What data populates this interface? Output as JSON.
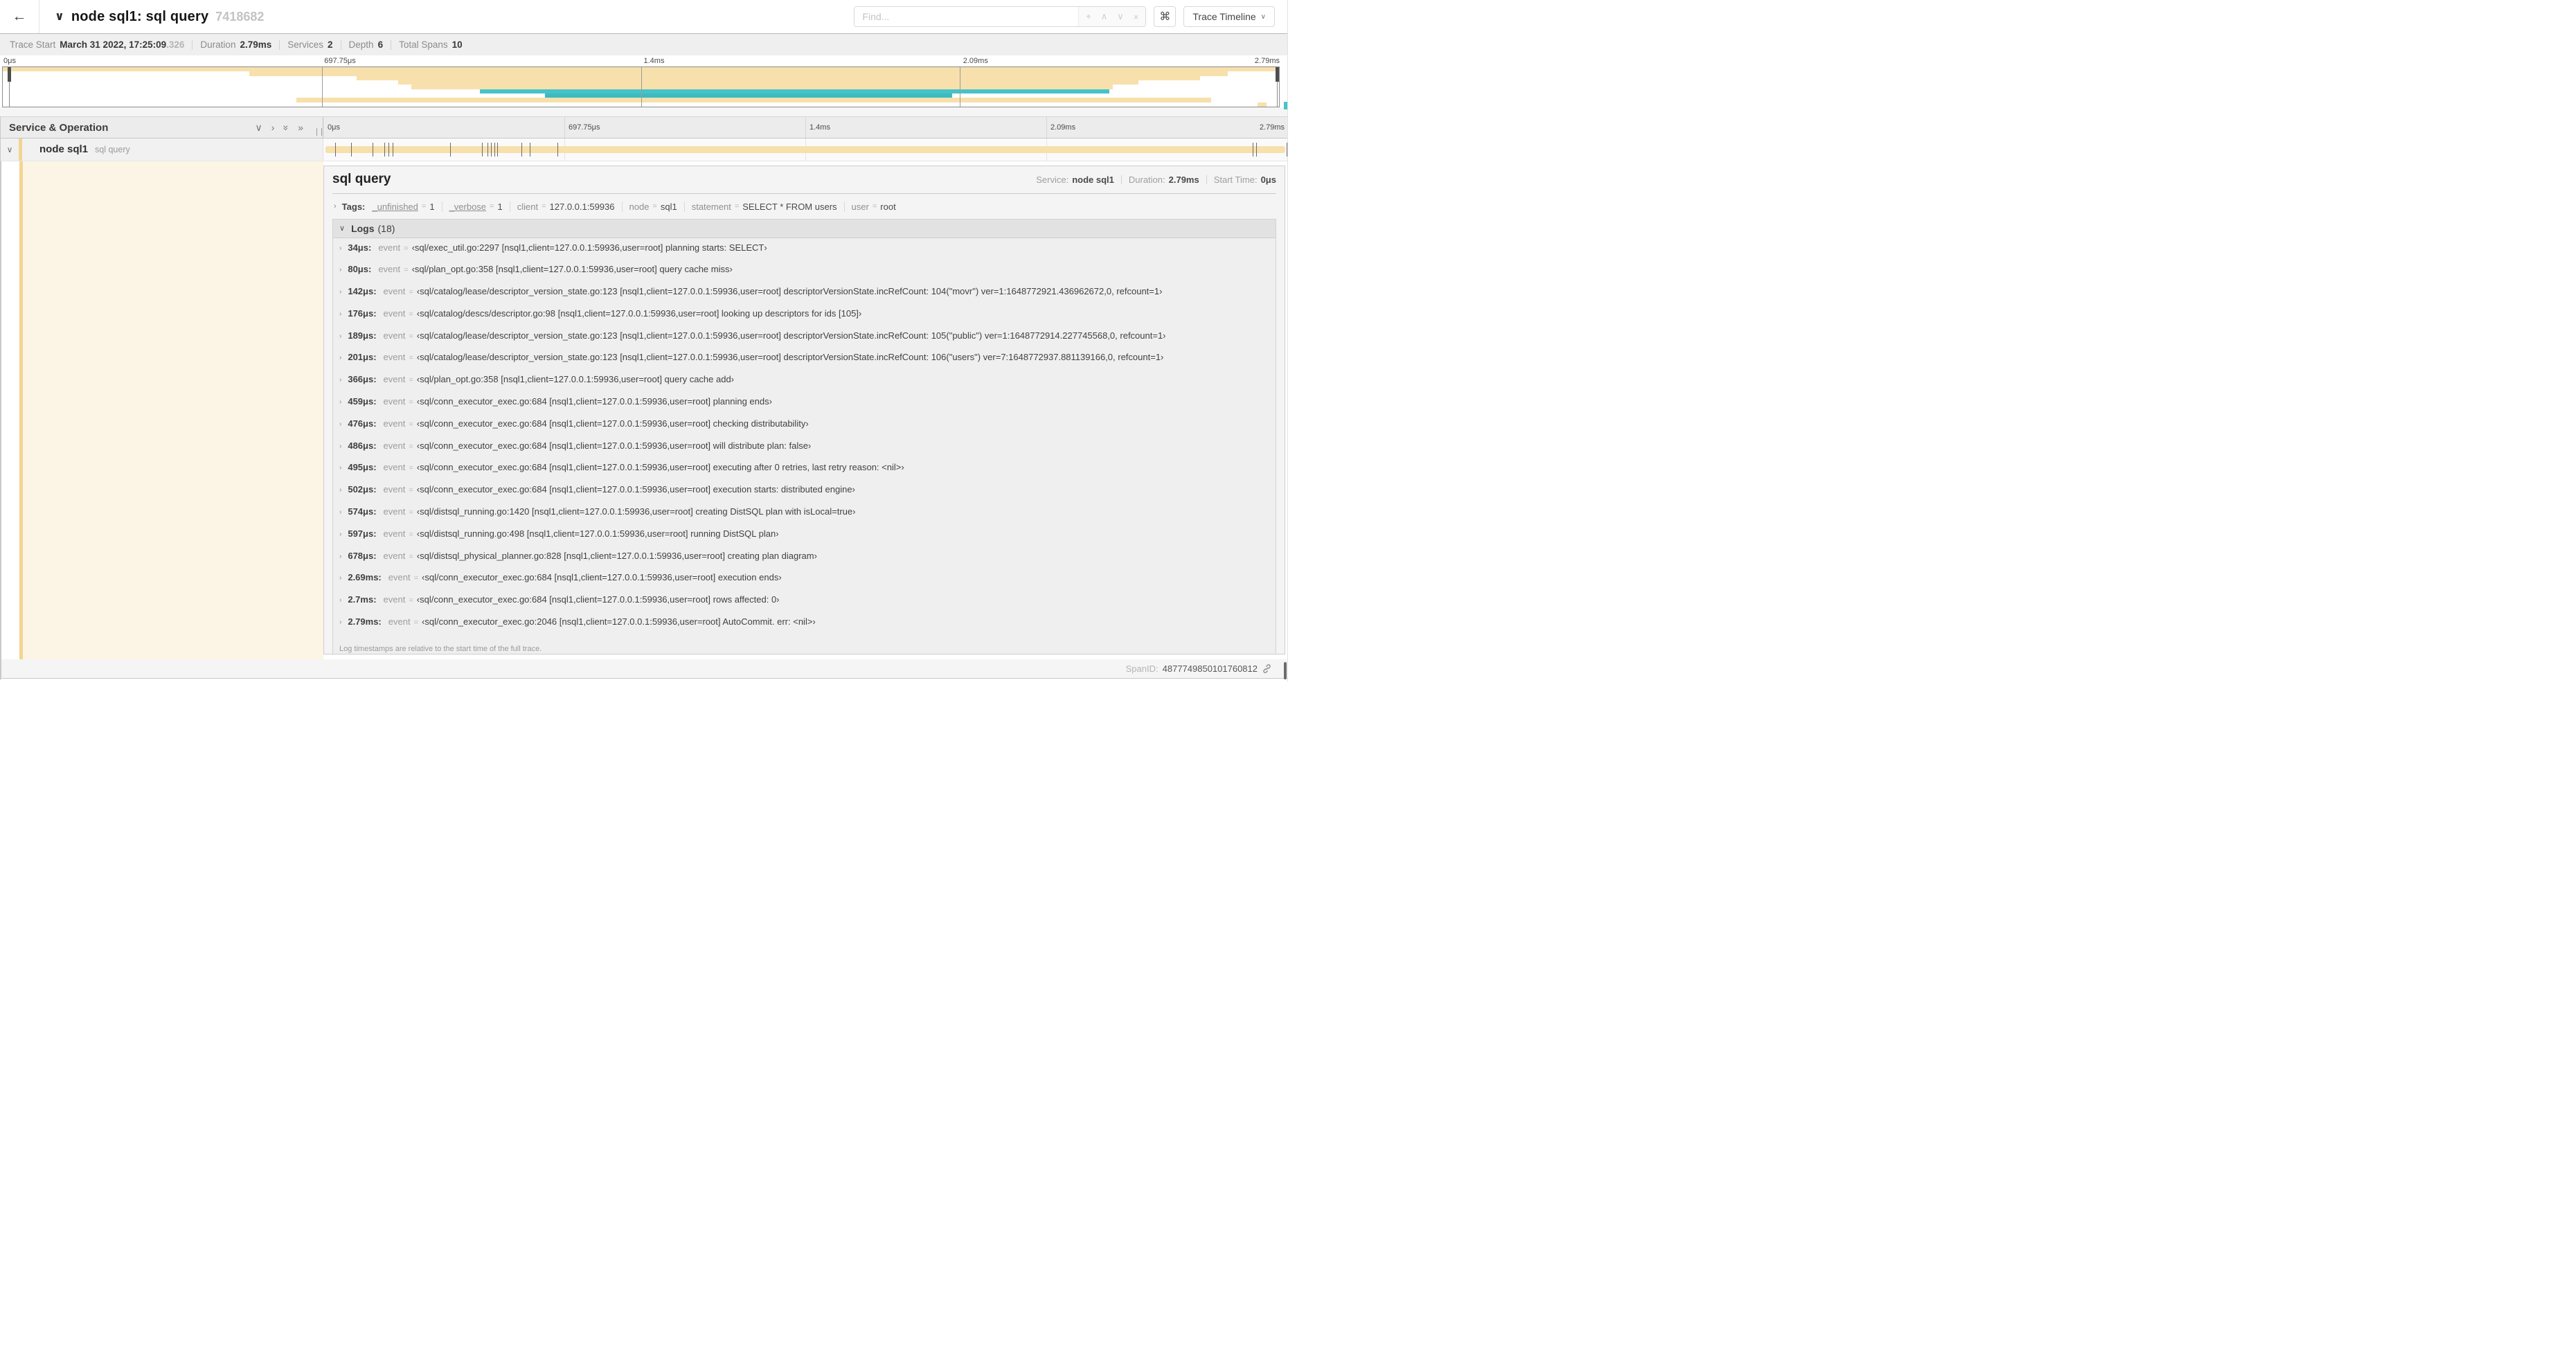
{
  "header": {
    "back_arrow": "←",
    "collapse_chevron": "∨",
    "title": "node sql1: sql query",
    "trace_id": "7418682",
    "find_placeholder": "Find...",
    "find_icons": [
      "⌖",
      "∧",
      "∨",
      "×"
    ],
    "shortcut_button": "⌘",
    "view_button": "Trace Timeline",
    "view_button_chevron": "∨"
  },
  "summary": {
    "items": [
      {
        "label": "Trace Start",
        "value": "March 31 2022, 17:25:09",
        "muted_suffix": ".326"
      },
      {
        "label": "Duration",
        "value": "2.79ms"
      },
      {
        "label": "Services",
        "value": "2"
      },
      {
        "label": "Depth",
        "value": "6"
      },
      {
        "label": "Total Spans",
        "value": "10"
      }
    ]
  },
  "colors": {
    "tan": "#F7E0AC",
    "tan_accent": "#F3D591",
    "teal": "#46C3C9",
    "teal_dark": "#3EBAC1",
    "cream": "#FCF5E5"
  },
  "minimap": {
    "ticks": [
      "0μs",
      "697.75μs",
      "1.4ms",
      "2.09ms",
      "2.79ms"
    ],
    "tick_pcts": [
      0,
      25,
      50,
      75,
      100
    ],
    "spans": [
      {
        "start": 0,
        "end": 100,
        "color": "tan"
      },
      {
        "start": 19.3,
        "end": 96,
        "color": "tan"
      },
      {
        "start": 27.7,
        "end": 93.8,
        "color": "tan"
      },
      {
        "start": 31,
        "end": 89,
        "color": "tan"
      },
      {
        "start": 32,
        "end": 87,
        "color": "tan"
      },
      {
        "start": 37.4,
        "end": 86.7,
        "color": "teal"
      },
      {
        "start": 42.5,
        "end": 74.4,
        "color": "teal_dark"
      },
      {
        "start": 23,
        "end": 94.7,
        "color": "tan"
      },
      {
        "start": 98.3,
        "end": 99,
        "color": "tan"
      }
    ]
  },
  "timeline": {
    "left_header": "Service & Operation",
    "ticks": [
      "0μs",
      "697.75μs",
      "1.4ms",
      "2.09ms",
      "2.79ms"
    ],
    "tick_pcts": [
      0,
      25,
      50,
      75,
      100
    ]
  },
  "span_row": {
    "chevron": "∨",
    "service": "node sql1",
    "operation": "sql query",
    "bar_start": 0.2,
    "bar_end": 99.8,
    "log_marker_pcts": [
      1.22,
      2.87,
      5.09,
      6.31,
      6.77,
      7.2,
      13.12,
      16.45,
      17.06,
      17.42,
      17.74,
      18.0,
      20.57,
      21.4,
      24.3,
      96.42,
      96.77,
      99.93
    ]
  },
  "detail": {
    "operation": "sql query",
    "meta": [
      {
        "label": "Service:",
        "value": "node sql1"
      },
      {
        "label": "Duration:",
        "value": "2.79ms"
      },
      {
        "label": "Start Time:",
        "value": "0μs"
      }
    ],
    "tags_label": "Tags:",
    "tags": [
      {
        "key": "_unfinished",
        "value": "1"
      },
      {
        "key": "_verbose",
        "value": "1"
      },
      {
        "key": "client",
        "value": "127.0.0.1:59936"
      },
      {
        "key": "node",
        "value": "sql1"
      },
      {
        "key": "statement",
        "value": "SELECT * FROM users"
      },
      {
        "key": "user",
        "value": "root"
      }
    ],
    "logs_label": "Logs",
    "logs_count": "(18)",
    "log_field_key": "event",
    "logs": [
      {
        "time": "34μs:",
        "value": "‹sql/exec_util.go:2297 [nsql1,client=127.0.0.1:59936,user=root] planning starts: SELECT›"
      },
      {
        "time": "80μs:",
        "value": "‹sql/plan_opt.go:358 [nsql1,client=127.0.0.1:59936,user=root] query cache miss›"
      },
      {
        "time": "142μs:",
        "value": "‹sql/catalog/lease/descriptor_version_state.go:123 [nsql1,client=127.0.0.1:59936,user=root] descriptorVersionState.incRefCount: 104(\"movr\") ver=1:1648772921.436962672,0, refcount=1›"
      },
      {
        "time": "176μs:",
        "value": "‹sql/catalog/descs/descriptor.go:98 [nsql1,client=127.0.0.1:59936,user=root] looking up descriptors for ids [105]›"
      },
      {
        "time": "189μs:",
        "value": "‹sql/catalog/lease/descriptor_version_state.go:123 [nsql1,client=127.0.0.1:59936,user=root] descriptorVersionState.incRefCount: 105(\"public\") ver=1:1648772914.227745568,0, refcount=1›"
      },
      {
        "time": "201μs:",
        "value": "‹sql/catalog/lease/descriptor_version_state.go:123 [nsql1,client=127.0.0.1:59936,user=root] descriptorVersionState.incRefCount: 106(\"users\") ver=7:1648772937.881139166,0, refcount=1›"
      },
      {
        "time": "366μs:",
        "value": "‹sql/plan_opt.go:358 [nsql1,client=127.0.0.1:59936,user=root] query cache add›"
      },
      {
        "time": "459μs:",
        "value": "‹sql/conn_executor_exec.go:684 [nsql1,client=127.0.0.1:59936,user=root] planning ends›"
      },
      {
        "time": "476μs:",
        "value": "‹sql/conn_executor_exec.go:684 [nsql1,client=127.0.0.1:59936,user=root] checking distributability›"
      },
      {
        "time": "486μs:",
        "value": "‹sql/conn_executor_exec.go:684 [nsql1,client=127.0.0.1:59936,user=root] will distribute plan: false›"
      },
      {
        "time": "495μs:",
        "value": "‹sql/conn_executor_exec.go:684 [nsql1,client=127.0.0.1:59936,user=root] executing after 0 retries, last retry reason: <nil>›"
      },
      {
        "time": "502μs:",
        "value": "‹sql/conn_executor_exec.go:684 [nsql1,client=127.0.0.1:59936,user=root] execution starts: distributed engine›"
      },
      {
        "time": "574μs:",
        "value": "‹sql/distsql_running.go:1420 [nsql1,client=127.0.0.1:59936,user=root] creating DistSQL plan with isLocal=true›"
      },
      {
        "time": "597μs:",
        "value": "‹sql/distsql_running.go:498 [nsql1,client=127.0.0.1:59936,user=root] running DistSQL plan›"
      },
      {
        "time": "678μs:",
        "value": "‹sql/distsql_physical_planner.go:828 [nsql1,client=127.0.0.1:59936,user=root] creating plan diagram›"
      },
      {
        "time": "2.69ms:",
        "value": "‹sql/conn_executor_exec.go:684 [nsql1,client=127.0.0.1:59936,user=root] execution ends›"
      },
      {
        "time": "2.7ms:",
        "value": "‹sql/conn_executor_exec.go:684 [nsql1,client=127.0.0.1:59936,user=root] rows affected: 0›"
      },
      {
        "time": "2.79ms:",
        "value": "‹sql/conn_executor_exec.go:2046 [nsql1,client=127.0.0.1:59936,user=root] AutoCommit. err: <nil>›"
      }
    ],
    "footnote": "Log timestamps are relative to the start time of the full trace.",
    "span_id_label": "SpanID:",
    "span_id": "4877749850101760812"
  }
}
